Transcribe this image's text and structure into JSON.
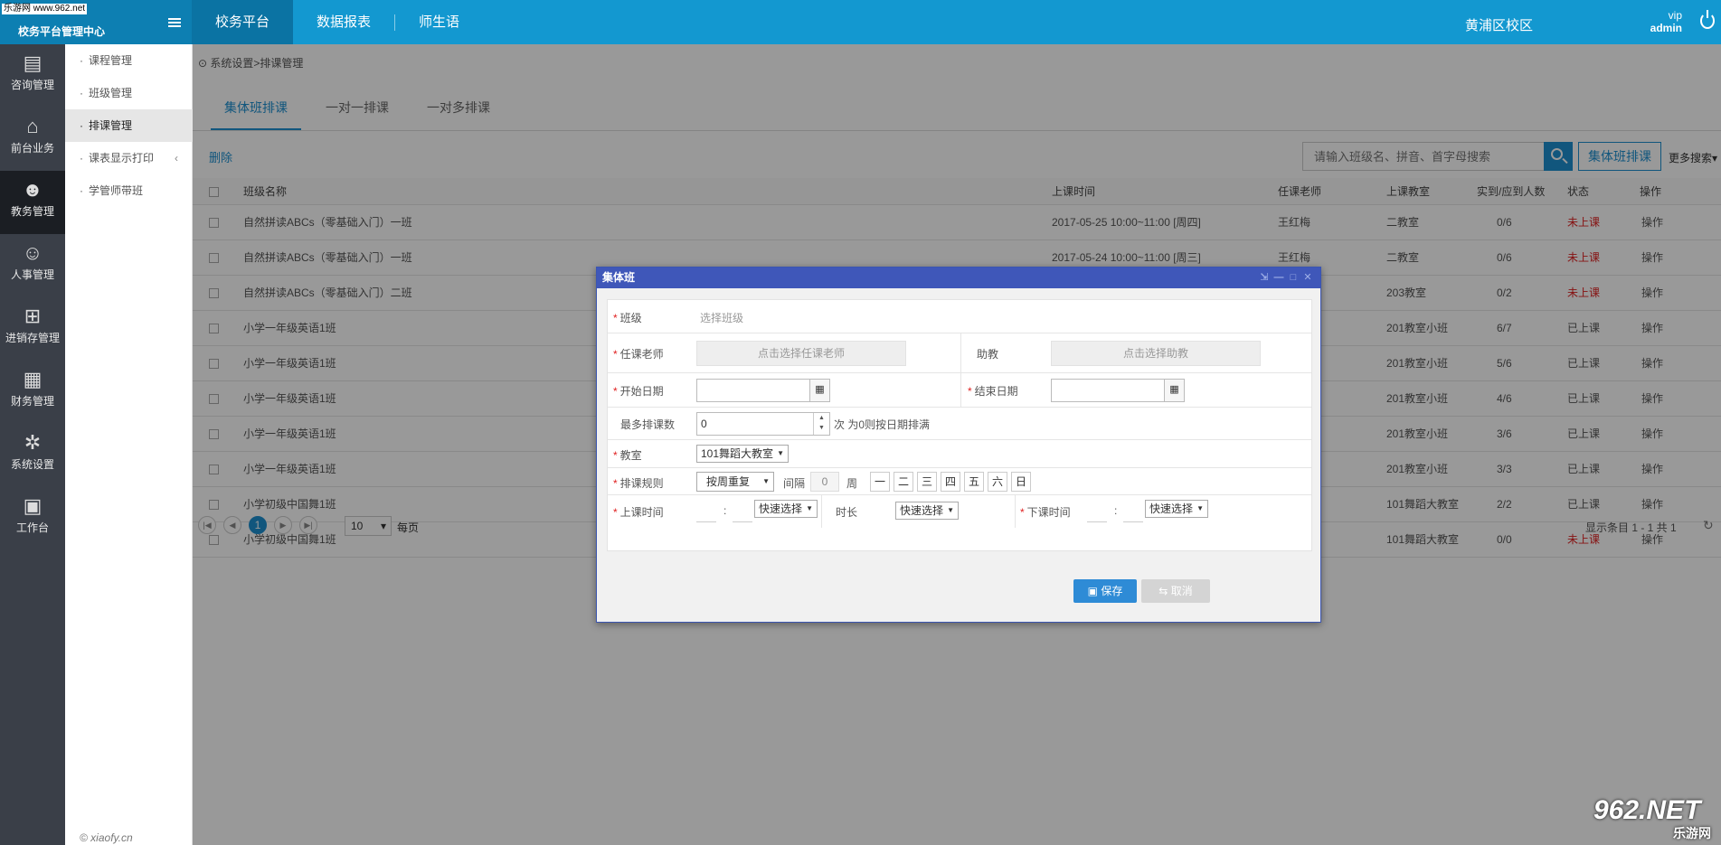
{
  "watermark_tl": "乐游网 www.962.net",
  "brand": {
    "subtitle": "校务平台管理中心"
  },
  "topnav": [
    {
      "label": "校务平台"
    },
    {
      "label": "数据报表"
    },
    {
      "label": "师生语"
    }
  ],
  "campus": "黄浦区校区",
  "user": {
    "level": "vip",
    "name": "admin"
  },
  "leftnav": [
    {
      "label": "咨询管理",
      "icon": "book-icon"
    },
    {
      "label": "前台业务",
      "icon": "store-icon"
    },
    {
      "label": "教务管理",
      "icon": "users-icon"
    },
    {
      "label": "人事管理",
      "icon": "person-icon"
    },
    {
      "label": "进销存管理",
      "icon": "basket-icon"
    },
    {
      "label": "财务管理",
      "icon": "finance-icon"
    },
    {
      "label": "系统设置",
      "icon": "gear-icon"
    },
    {
      "label": "工作台",
      "icon": "image-icon"
    }
  ],
  "subnav": [
    {
      "label": "课程管理"
    },
    {
      "label": "班级管理"
    },
    {
      "label": "排课管理"
    },
    {
      "label": "课表显示打印"
    },
    {
      "label": "学管师带班"
    }
  ],
  "copyright": "© xiaofy.cn",
  "breadcrumb": "系统设置>排课管理",
  "tabs": [
    {
      "label": "集体班排课"
    },
    {
      "label": "一对一排课"
    },
    {
      "label": "一对多排课"
    }
  ],
  "toolbar": {
    "delete": "删除",
    "search_placeholder": "请输入班级名、拼音、首字母搜索",
    "group_schedule": "集体班排课",
    "more_search": "更多搜索▾"
  },
  "table": {
    "headers": {
      "name": "班级名称",
      "time": "上课时间",
      "teacher": "任课老师",
      "room": "上课教室",
      "count": "实到/应到人数",
      "status": "状态",
      "ops": "操作"
    },
    "rows": [
      {
        "name": "自然拼读ABCs（零基础入门）一班",
        "time": "2017-05-25 10:00~11:00 [周四]",
        "teacher": "王红梅",
        "room": "二教室",
        "count": "0/6",
        "status": "未上课",
        "ops": "操作"
      },
      {
        "name": "自然拼读ABCs（零基础入门）一班",
        "time": "2017-05-24 10:00~11:00 [周三]",
        "teacher": "王红梅",
        "room": "二教室",
        "count": "0/6",
        "status": "未上课",
        "ops": "操作"
      },
      {
        "name": "自然拼读ABCs（零基础入门）二班",
        "time": "",
        "teacher": "",
        "room": "203教室",
        "count": "0/2",
        "status": "未上课",
        "ops": "操作"
      },
      {
        "name": "小学一年级英语1班",
        "time": "",
        "teacher": "",
        "room": "201教室小班",
        "count": "6/7",
        "status": "已上课",
        "ops": "操作"
      },
      {
        "name": "小学一年级英语1班",
        "time": "",
        "teacher": "",
        "room": "201教室小班",
        "count": "5/6",
        "status": "已上课",
        "ops": "操作"
      },
      {
        "name": "小学一年级英语1班",
        "time": "",
        "teacher": "",
        "room": "201教室小班",
        "count": "4/6",
        "status": "已上课",
        "ops": "操作"
      },
      {
        "name": "小学一年级英语1班",
        "time": "",
        "teacher": "",
        "room": "201教室小班",
        "count": "3/6",
        "status": "已上课",
        "ops": "操作"
      },
      {
        "name": "小学一年级英语1班",
        "time": "",
        "teacher": "",
        "room": "201教室小班",
        "count": "3/3",
        "status": "已上课",
        "ops": "操作"
      },
      {
        "name": "小学初级中国舞1班",
        "time": "",
        "teacher": "",
        "room": "101舞蹈大教室",
        "count": "2/2",
        "status": "已上课",
        "ops": "操作"
      },
      {
        "name": "小学初级中国舞1班",
        "time": "",
        "teacher": "",
        "room": "101舞蹈大教室",
        "count": "0/0",
        "status": "未上课",
        "ops": "操作"
      }
    ]
  },
  "pager": {
    "current": "1",
    "page_size": "10",
    "per_page_label": "每页",
    "info": "显示条目 1 - 1 共 1"
  },
  "dialog": {
    "title": "集体班",
    "class_label": "班级",
    "class_placeholder": "选择班级",
    "teacher_label": "任课老师",
    "teacher_btn": "点击选择任课老师",
    "assistant_label": "助教",
    "assistant_btn": "点击选择助教",
    "start_label": "开始日期",
    "end_label": "结束日期",
    "max_label": "最多排课数",
    "max_value": "0",
    "max_hint": "次 为0则按日期排满",
    "room_label": "教室",
    "room_value": "101舞蹈大教室",
    "rule_label": "排课规则",
    "rule_value": "按周重复",
    "interval_label": "间隔",
    "interval_value": "0",
    "week_label": "周",
    "weekdays": [
      "一",
      "二",
      "三",
      "四",
      "五",
      "六",
      "日"
    ],
    "start_time_label": "上课时间",
    "quick_select": "快速选择",
    "duration_label": "时长",
    "end_time_label": "下课时间",
    "colon": ":",
    "save": "保存",
    "cancel": "取消"
  },
  "watermark_br": {
    "top": "962.NET",
    "bottom": "乐游网"
  }
}
